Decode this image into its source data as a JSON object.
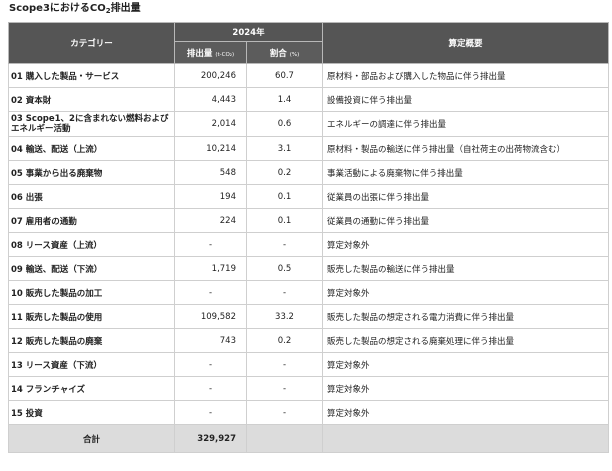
{
  "title_prefix": "Scope3におけるCO",
  "title_sub": "2",
  "title_suffix": "排出量",
  "header": {
    "category": "カテゴリー",
    "year": "2024年",
    "emission": "排出量",
    "emission_unit": "(t-CO₂)",
    "ratio": "割合",
    "ratio_unit": "(%)",
    "summary": "算定概要"
  },
  "rows": [
    {
      "cat": "01 購入した製品・サービス",
      "emission": "200,246",
      "ratio": "60.7",
      "desc": "原材料・部品および購入した物品に伴う排出量"
    },
    {
      "cat": "02 資本財",
      "emission": "4,443",
      "ratio": "1.4",
      "desc": "設備投資に伴う排出量"
    },
    {
      "cat": "03 Scope1、2に含まれない燃料およびエネルギー活動",
      "emission": "2,014",
      "ratio": "0.6",
      "desc": "エネルギーの調達に伴う排出量"
    },
    {
      "cat": "04 輸送、配送（上流）",
      "emission": "10,214",
      "ratio": "3.1",
      "desc": "原材料・製品の輸送に伴う排出量（自社荷主の出荷物流含む）"
    },
    {
      "cat": "05 事業から出る廃棄物",
      "emission": "548",
      "ratio": "0.2",
      "desc": "事業活動による廃棄物に伴う排出量"
    },
    {
      "cat": "06 出張",
      "emission": "194",
      "ratio": "0.1",
      "desc": "従業員の出張に伴う排出量"
    },
    {
      "cat": "07 雇用者の通勤",
      "emission": "224",
      "ratio": "0.1",
      "desc": "従業員の通勤に伴う排出量"
    },
    {
      "cat": "08 リース資産（上流）",
      "emission": "-",
      "ratio": "-",
      "desc": "算定対象外"
    },
    {
      "cat": "09 輸送、配送（下流）",
      "emission": "1,719",
      "ratio": "0.5",
      "desc": "販売した製品の輸送に伴う排出量"
    },
    {
      "cat": "10 販売した製品の加工",
      "emission": "-",
      "ratio": "-",
      "desc": "算定対象外"
    },
    {
      "cat": "11 販売した製品の使用",
      "emission": "109,582",
      "ratio": "33.2",
      "desc": "販売した製品の想定される電力消費に伴う排出量"
    },
    {
      "cat": "12 販売した製品の廃棄",
      "emission": "743",
      "ratio": "0.2",
      "desc": "販売した製品の想定される廃棄処理に伴う排出量"
    },
    {
      "cat": "13 リース資産（下流）",
      "emission": "-",
      "ratio": "-",
      "desc": "算定対象外"
    },
    {
      "cat": "14 フランチャイズ",
      "emission": "-",
      "ratio": "-",
      "desc": "算定対象外"
    },
    {
      "cat": "15 投資",
      "emission": "-",
      "ratio": "-",
      "desc": "算定対象外"
    }
  ],
  "total": {
    "label": "合計",
    "emission": "329,927"
  }
}
